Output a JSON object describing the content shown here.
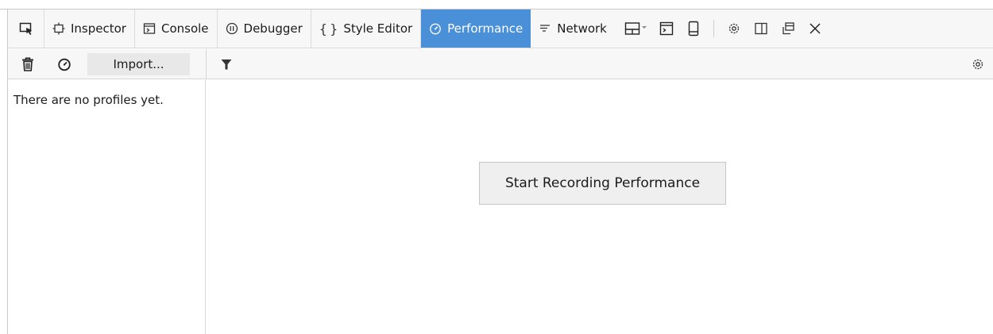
{
  "toolbox": {
    "picker_icon": "element-picker-icon",
    "tabs": [
      {
        "label": "Inspector",
        "icon": "inspector-icon",
        "selected": false
      },
      {
        "label": "Console",
        "icon": "console-icon",
        "selected": false
      },
      {
        "label": "Debugger",
        "icon": "debugger-icon",
        "selected": false
      },
      {
        "label": "Style Editor",
        "icon": "style-editor-icon",
        "selected": false
      },
      {
        "label": "Performance",
        "icon": "performance-icon",
        "selected": true
      },
      {
        "label": "Network",
        "icon": "network-icon",
        "selected": false
      }
    ],
    "tools": [
      "responsive-layout-icon",
      "scratchpad-icon",
      "screenshot-icon",
      "settings-icon",
      "dock-side-icon",
      "separate-window-icon",
      "close-icon"
    ],
    "selected_color": "#4a90d9"
  },
  "perf_toolbar": {
    "clear_icon": "trash-icon",
    "record_icon": "stopwatch-icon",
    "import_label": "Import...",
    "filter_icon": "filter-icon",
    "options_icon": "settings-icon"
  },
  "sidebar": {
    "empty_text": "There are no profiles yet."
  },
  "main": {
    "record_button_label": "Start Recording Performance"
  }
}
